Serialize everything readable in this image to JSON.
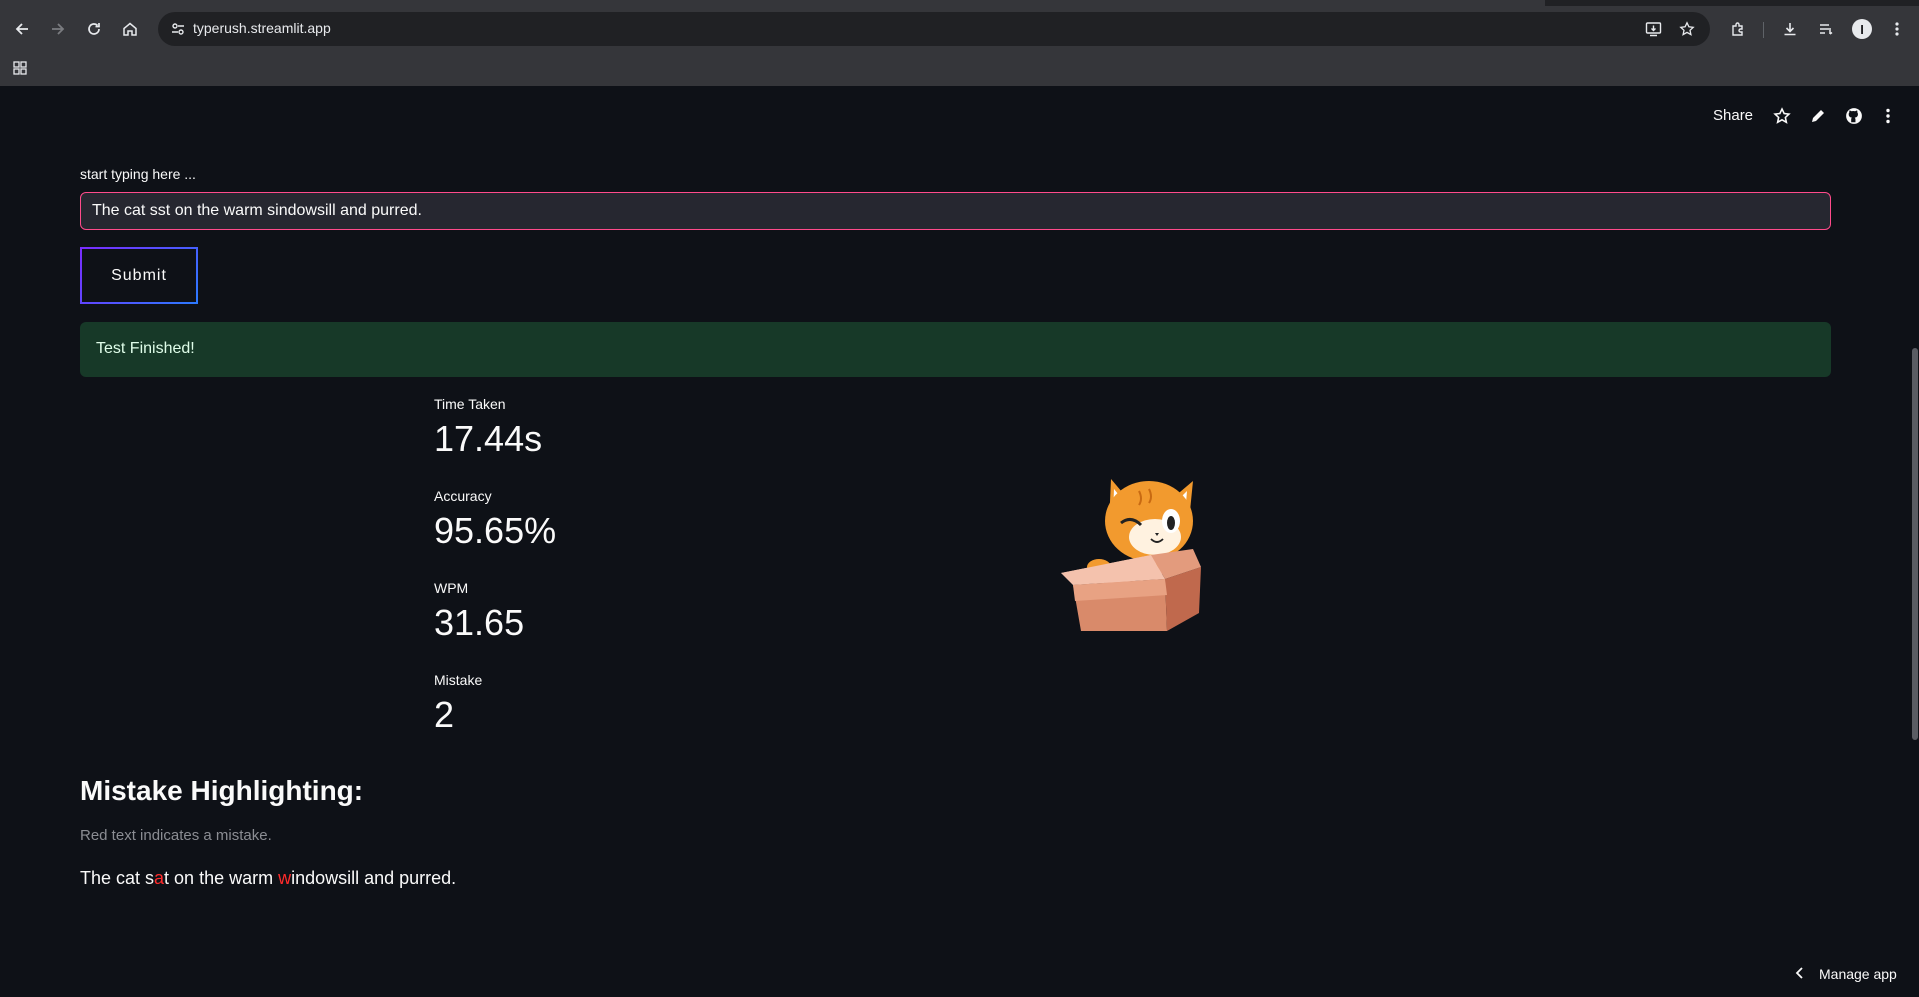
{
  "browser": {
    "url": "typerush.streamlit.app",
    "icons": {
      "back": "arrow-left-icon",
      "forward": "arrow-right-icon",
      "reload": "reload-icon",
      "home": "home-icon",
      "site_info": "site-settings-icon",
      "install": "install-app-icon",
      "bookmark": "star-icon",
      "extensions": "puzzle-icon",
      "downloads": "download-icon",
      "media": "media-queue-icon",
      "profile": "profile-avatar",
      "menu": "kebab-menu-icon",
      "apps": "apps-grid-icon"
    },
    "profile_initial": "I"
  },
  "header": {
    "share_label": "Share"
  },
  "input": {
    "label": "start typing here ...",
    "value": "The cat sst on the warm sindowsill and purred."
  },
  "submit_label": "Submit",
  "status": {
    "message": "Test Finished!",
    "color": "#173928"
  },
  "metrics": [
    {
      "label": "Time Taken",
      "value": "17.44s"
    },
    {
      "label": "Accuracy",
      "value": "95.65%"
    },
    {
      "label": "WPM",
      "value": "31.65"
    },
    {
      "label": "Mistake",
      "value": "2"
    }
  ],
  "mistake_section": {
    "title": "Mistake Highlighting:",
    "caption": "Red text indicates a mistake.",
    "segments": [
      {
        "text": "The cat s",
        "error": false
      },
      {
        "text": "a",
        "error": true
      },
      {
        "text": "t on the warm ",
        "error": false
      },
      {
        "text": "w",
        "error": true
      },
      {
        "text": "indowsill and purred.",
        "error": false
      }
    ]
  },
  "footer": {
    "manage_app": "Manage app"
  },
  "colors": {
    "background": "#0e1117",
    "input_border": "#ff4b8b",
    "error_text": "#ff2b2b"
  }
}
